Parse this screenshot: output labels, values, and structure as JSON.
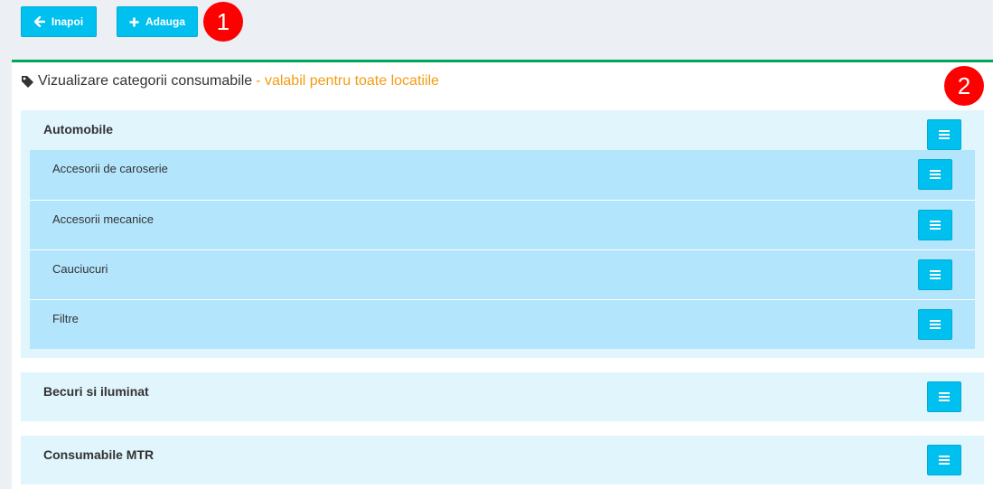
{
  "toolbar": {
    "back_label": "Inapoi",
    "add_label": "Adauga",
    "back_icon": "arrow-left-icon",
    "add_icon": "plus-icon"
  },
  "annotations": [
    "1",
    "2"
  ],
  "panel": {
    "title": "Vizualizare categorii consumabile",
    "note": " - valabil pentru toate locatiile",
    "title_icon": "tag-icon"
  },
  "categories": [
    {
      "name": "Automobile",
      "children": [
        {
          "name": "Accesorii de caroserie"
        },
        {
          "name": "Accesorii mecanice"
        },
        {
          "name": "Cauciucuri"
        },
        {
          "name": "Filtre"
        }
      ]
    },
    {
      "name": "Becuri si iluminat",
      "children": []
    },
    {
      "name": "Consumabile MTR",
      "children": []
    }
  ],
  "colors": {
    "button": "#00c0ef",
    "panel_border": "#00a65a",
    "note": "#f39c12",
    "category_bg": "#e1f5fd",
    "subcategory_bg": "#b3e5fc",
    "badge": "#ff0000"
  }
}
